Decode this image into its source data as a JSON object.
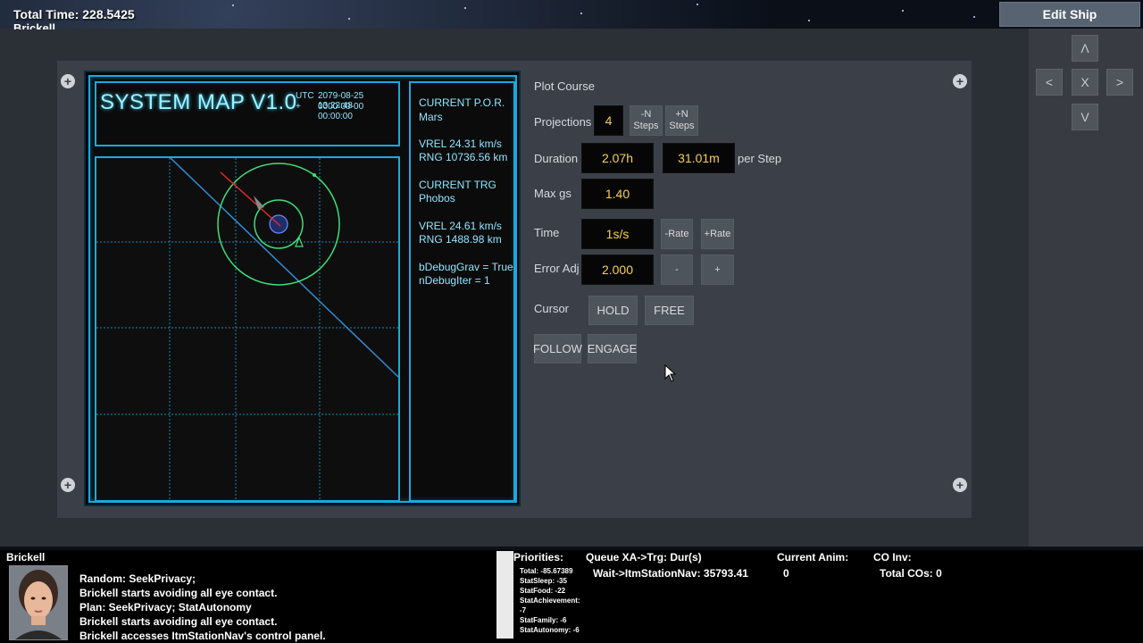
{
  "hud": {
    "total_time": "Total Time: 228.5425",
    "character_top": "Brickell",
    "edit_ship_label": "Edit Ship",
    "nav": {
      "up": "Λ",
      "left": "<",
      "center": "X",
      "right": ">",
      "down": "V"
    }
  },
  "corner_icons": [
    "plus-circle-icon",
    "plus-circle-icon",
    "plus-circle-icon",
    "plus-circle-icon"
  ],
  "map": {
    "title": "SYSTEM MAP V1.0",
    "utc_label": "UTC",
    "utc_plus": "+",
    "utc_datetime": "2079-08-25 13:22:48",
    "utc_offset": "0000-00-00 00:00:00",
    "info": {
      "por_label": "CURRENT P.O.R.",
      "por_value": "Mars",
      "vrel1": "VREL 24.31 km/s",
      "rng1": "RNG 10736.56 km",
      "trg_label": "CURRENT TRG",
      "trg_value": "Phobos",
      "vrel2": "VREL 24.61 km/s",
      "rng2": "RNG 1488.98 km",
      "debug1": "bDebugGrav = True",
      "debug2": "nDebugIter = 1"
    },
    "colors": {
      "frame": "#19a9e0",
      "orbit": "#3de07a",
      "course": "#2f8fd6",
      "vector": "#e02a2a"
    }
  },
  "plot": {
    "title": "Plot Course",
    "projections_label": "Projections",
    "projections_value": "4",
    "minus_steps": "-N Steps",
    "plus_steps": "+N Steps",
    "duration_label": "Duration",
    "duration_value": "2.07h",
    "step_value": "31.01m",
    "per_step": "per Step",
    "maxgs_label": "Max gs",
    "maxgs_value": "1.40",
    "time_label": "Time",
    "time_value": "1s/s",
    "rate_minus": "-Rate",
    "rate_plus": "+Rate",
    "error_label": "Error Adj",
    "error_value": "2.000",
    "error_minus": "-",
    "error_plus": "+",
    "cursor_label": "Cursor",
    "hold": "HOLD",
    "free": "FREE",
    "follow": "FOLLOW",
    "engage": "ENGAGE"
  },
  "footer": {
    "name": "Brickell",
    "log": [
      "Random: SeekPrivacy;",
      "Brickell starts avoiding all eye contact.",
      "Plan: SeekPrivacy; StatAutonomy",
      "Brickell starts avoiding all eye contact.",
      "Brickell accesses ItmStationNav's control panel."
    ],
    "priorities_label": "Priorities:",
    "priorities": [
      "Total: -85.67389",
      "StatSleep: -35",
      "StatFood: -22",
      "StatAchievement:",
      "-7",
      "StatFamily: -6",
      "StatAutonomy: -6"
    ],
    "queue_label": "Queue XA->Trg: Dur(s)",
    "queue_value": "Wait->ItmStationNav: 35793.41",
    "anim_label": "Current Anim:",
    "anim_value": "0",
    "coinv_label": "CO Inv:",
    "coinv_value": "Total COs: 0"
  }
}
